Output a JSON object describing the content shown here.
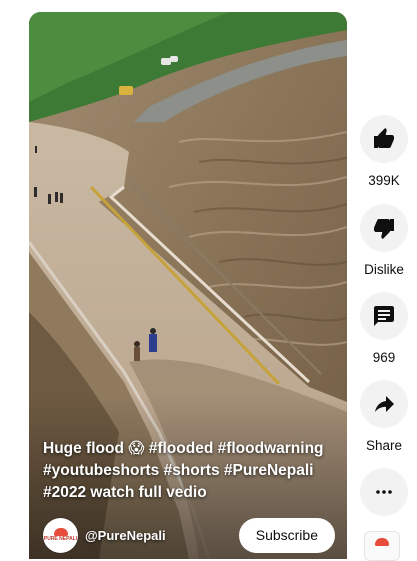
{
  "video": {
    "caption": "Huge flood 😱 #flooded #floodwarning #youtubeshorts #shorts #PureNepali #2022 watch full vedio",
    "channel_name": "@PureNepali",
    "avatar_text": "PURE NEPALI",
    "subscribe_label": "Subscribe"
  },
  "actions": {
    "like_count": "399K",
    "dislike_label": "Dislike",
    "comments_count": "969",
    "share_label": "Share"
  },
  "icons": {
    "like": "thumbs-up-icon",
    "dislike": "thumbs-down-icon",
    "comments": "comment-icon",
    "share": "share-icon",
    "more": "more-horizontal-icon"
  }
}
